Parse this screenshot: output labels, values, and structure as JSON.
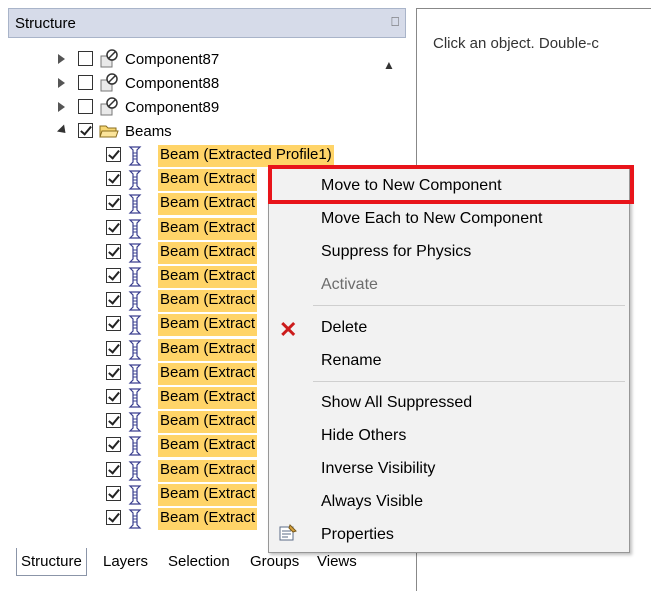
{
  "panel": {
    "title": "Structure"
  },
  "view": {
    "hint": "Click an object. Double-c"
  },
  "tree": {
    "components": [
      "Component87",
      "Component88",
      "Component89"
    ],
    "folder": "Beams",
    "first_beam": "Beam (Extracted Profile1)",
    "beam_truncated": "Beam (Extract",
    "beam_last_partial": "Beam (Extract"
  },
  "menu": {
    "items": [
      "Move to New Component",
      "Move Each to New Component",
      "Suppress for Physics",
      "Activate",
      "Delete",
      "Rename",
      "Show All Suppressed",
      "Hide Others",
      "Inverse Visibility",
      "Always Visible",
      "Properties"
    ]
  },
  "tabs": [
    "Structure",
    "Layers",
    "Selection",
    "Groups",
    "Views"
  ],
  "colors": {
    "highlight": "#ffd468",
    "annotation": "#e8141a",
    "header": "#d6dbe9"
  }
}
